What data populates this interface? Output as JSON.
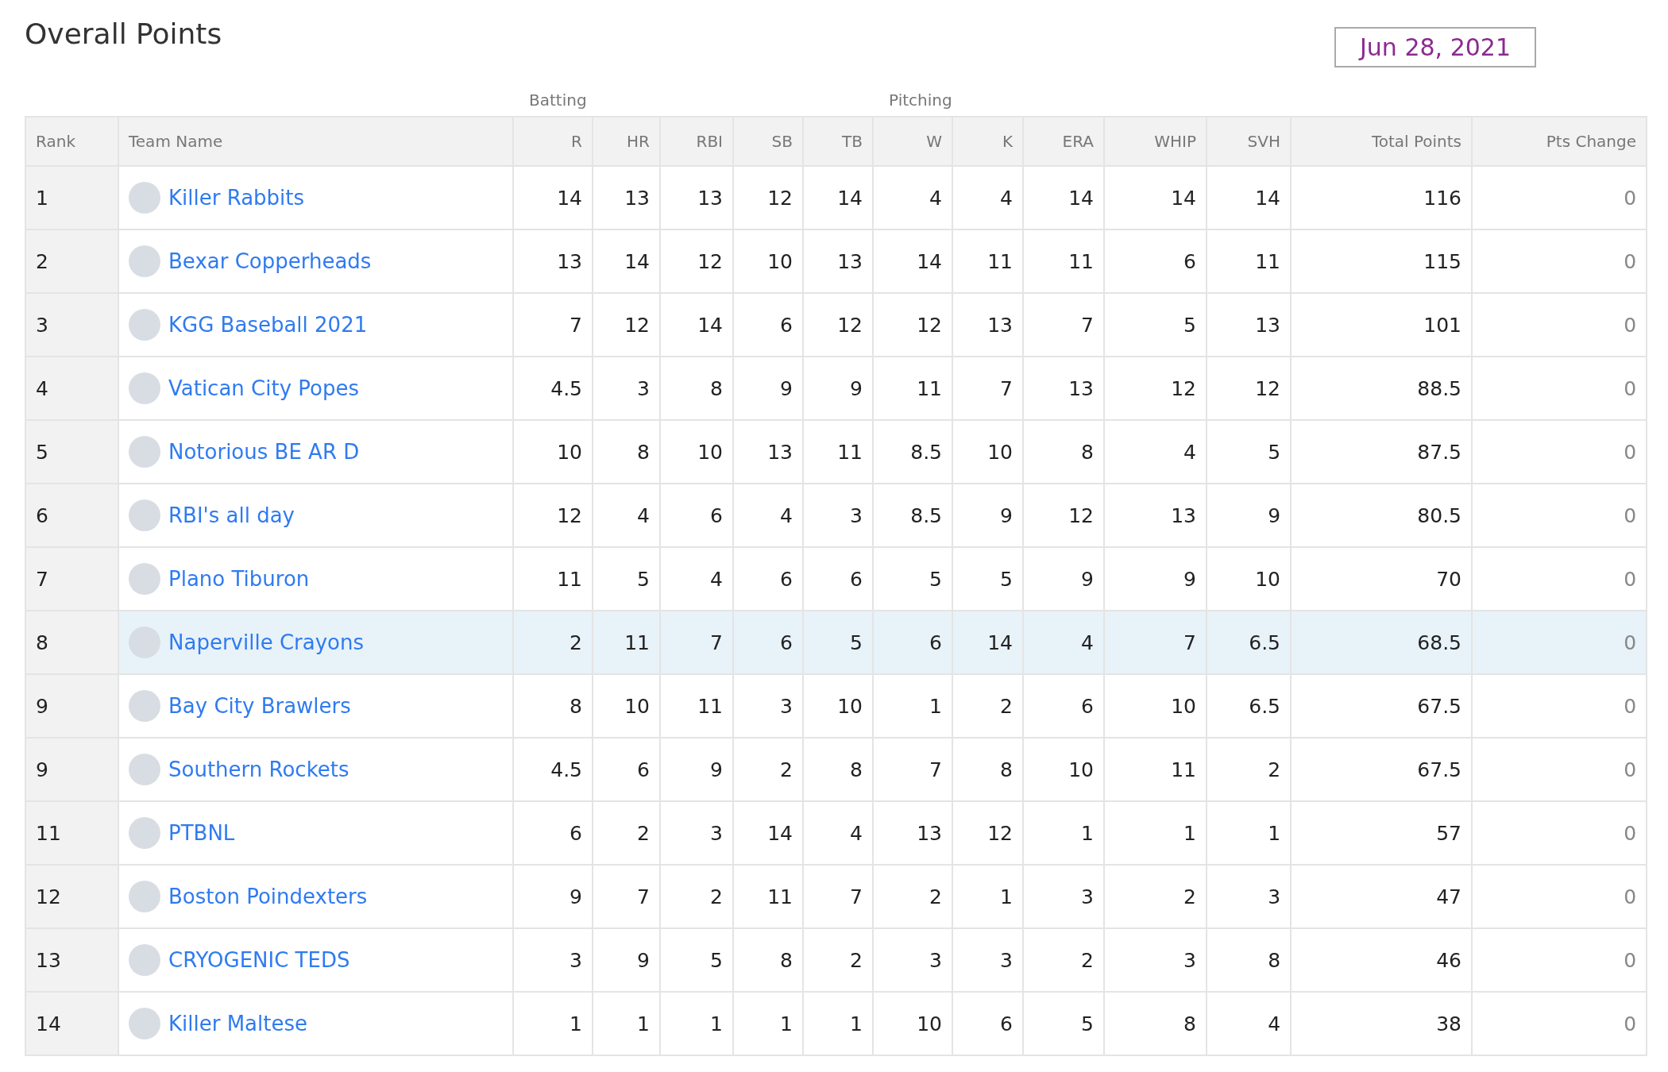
{
  "title": "Overall Points",
  "date": "Jun 28, 2021",
  "groups": [
    "Batting",
    "Pitching"
  ],
  "columns": [
    "Rank",
    "Team Name",
    "R",
    "HR",
    "RBI",
    "SB",
    "TB",
    "W",
    "K",
    "ERA",
    "WHIP",
    "SVH",
    "Total Points",
    "Pts Change"
  ],
  "rows": [
    {
      "rank": "1",
      "team": "Killer Rabbits",
      "stats": [
        "14",
        "13",
        "13",
        "12",
        "14",
        "4",
        "4",
        "14",
        "14",
        "14"
      ],
      "total": "116",
      "change": "0",
      "selected": false
    },
    {
      "rank": "2",
      "team": "Bexar Copperheads",
      "stats": [
        "13",
        "14",
        "12",
        "10",
        "13",
        "14",
        "11",
        "11",
        "6",
        "11"
      ],
      "total": "115",
      "change": "0",
      "selected": false
    },
    {
      "rank": "3",
      "team": "KGG Baseball 2021",
      "stats": [
        "7",
        "12",
        "14",
        "6",
        "12",
        "12",
        "13",
        "7",
        "5",
        "13"
      ],
      "total": "101",
      "change": "0",
      "selected": false
    },
    {
      "rank": "4",
      "team": "Vatican City Popes",
      "stats": [
        "4.5",
        "3",
        "8",
        "9",
        "9",
        "11",
        "7",
        "13",
        "12",
        "12"
      ],
      "total": "88.5",
      "change": "0",
      "selected": false
    },
    {
      "rank": "5",
      "team": "Notorious BE AR D",
      "stats": [
        "10",
        "8",
        "10",
        "13",
        "11",
        "8.5",
        "10",
        "8",
        "4",
        "5"
      ],
      "total": "87.5",
      "change": "0",
      "selected": false
    },
    {
      "rank": "6",
      "team": "RBI's all day",
      "stats": [
        "12",
        "4",
        "6",
        "4",
        "3",
        "8.5",
        "9",
        "12",
        "13",
        "9"
      ],
      "total": "80.5",
      "change": "0",
      "selected": false
    },
    {
      "rank": "7",
      "team": "Plano Tiburon",
      "stats": [
        "11",
        "5",
        "4",
        "6",
        "6",
        "5",
        "5",
        "9",
        "9",
        "10"
      ],
      "total": "70",
      "change": "0",
      "selected": false
    },
    {
      "rank": "8",
      "team": "Naperville Crayons",
      "stats": [
        "2",
        "11",
        "7",
        "6",
        "5",
        "6",
        "14",
        "4",
        "7",
        "6.5"
      ],
      "total": "68.5",
      "change": "0",
      "selected": true
    },
    {
      "rank": "9",
      "team": "Bay City Brawlers",
      "stats": [
        "8",
        "10",
        "11",
        "3",
        "10",
        "1",
        "2",
        "6",
        "10",
        "6.5"
      ],
      "total": "67.5",
      "change": "0",
      "selected": false
    },
    {
      "rank": "9",
      "team": "Southern Rockets",
      "stats": [
        "4.5",
        "6",
        "9",
        "2",
        "8",
        "7",
        "8",
        "10",
        "11",
        "2"
      ],
      "total": "67.5",
      "change": "0",
      "selected": false
    },
    {
      "rank": "11",
      "team": "PTBNL",
      "stats": [
        "6",
        "2",
        "3",
        "14",
        "4",
        "13",
        "12",
        "1",
        "1",
        "1"
      ],
      "total": "57",
      "change": "0",
      "selected": false
    },
    {
      "rank": "12",
      "team": "Boston Poindexters",
      "stats": [
        "9",
        "7",
        "2",
        "11",
        "7",
        "2",
        "1",
        "3",
        "2",
        "3"
      ],
      "total": "47",
      "change": "0",
      "selected": false
    },
    {
      "rank": "13",
      "team": "CRYOGENIC TEDS",
      "stats": [
        "3",
        "9",
        "5",
        "8",
        "2",
        "3",
        "3",
        "2",
        "3",
        "8"
      ],
      "total": "46",
      "change": "0",
      "selected": false
    },
    {
      "rank": "14",
      "team": "Killer Maltese",
      "stats": [
        "1",
        "1",
        "1",
        "1",
        "1",
        "10",
        "6",
        "5",
        "8",
        "4"
      ],
      "total": "38",
      "change": "0",
      "selected": false
    }
  ]
}
